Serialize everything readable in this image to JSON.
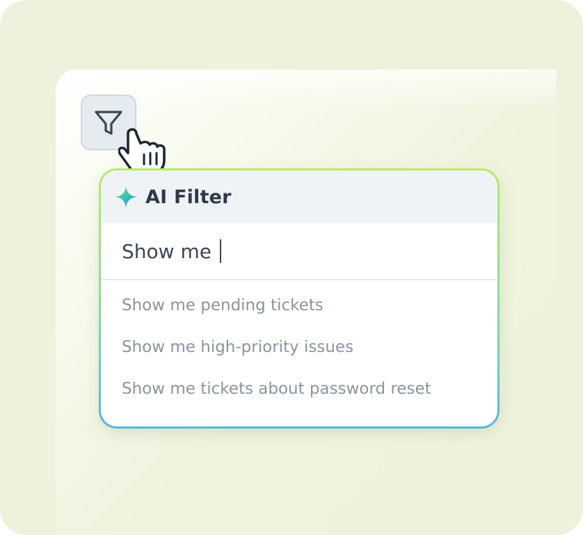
{
  "filter_button": {
    "icon": "filter-icon"
  },
  "cursor": {
    "icon": "hand-pointer-icon"
  },
  "ai_filter": {
    "icon": "sparkle-icon",
    "title": "AI Filter",
    "input_value": "Show me",
    "suggestions": [
      "Show me pending tickets",
      "Show me high-priority issues",
      "Show me tickets about password reset"
    ]
  },
  "colors": {
    "background": "#eef2dc",
    "border_gradient_top": "#b9ea63",
    "border_gradient_bottom": "#4cb8e0",
    "title_text": "#2e3a48",
    "suggestion_text": "#8a949e"
  }
}
